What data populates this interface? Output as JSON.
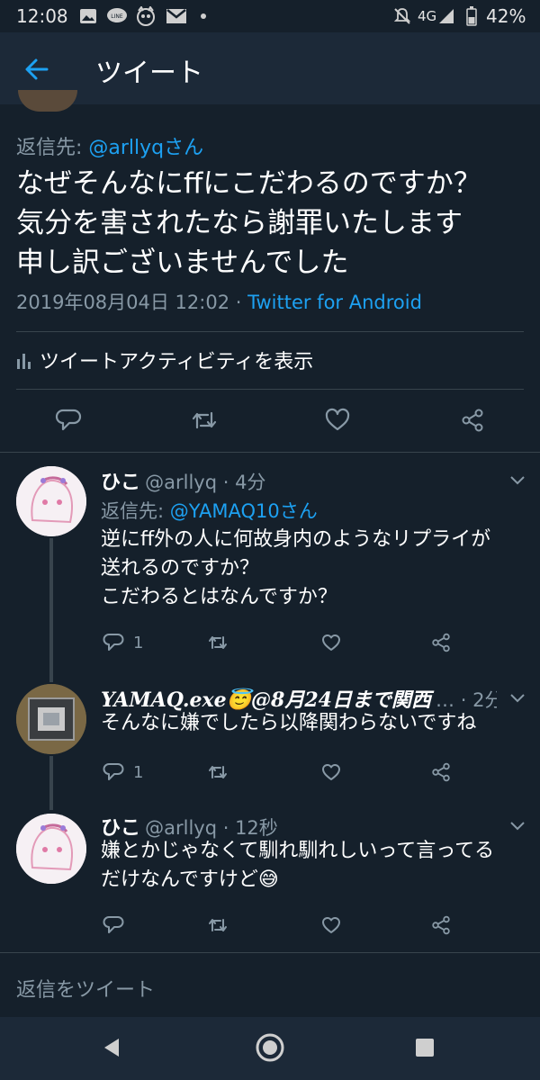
{
  "status_bar": {
    "time": "12:08",
    "network": "4G",
    "battery": "42%"
  },
  "header": {
    "title": "ツイート"
  },
  "main_tweet": {
    "reply_to_prefix": "返信先: ",
    "reply_to_user": "@arllyqさん",
    "text": "なぜそんなにffにこだわるのですか？\n気分を害されたなら謝罪いたします\n申し訳ございませんでした",
    "timestamp": "2019年08月04日 12:02",
    "separator": " · ",
    "source": "Twitter for Android",
    "activity_label": "ツイートアクティビティを表示"
  },
  "replies": [
    {
      "name": "ひこ",
      "handle": "@arllyq",
      "time": " · 4分",
      "reply_to_prefix": "返信先: ",
      "reply_to_user": "@YAMAQ10さん",
      "text": "逆にff外の人に何故身内のようなリプライが\n送れるのですか？\nこだわるとはなんですか？",
      "reply_count": "1"
    },
    {
      "name": "YAMAQ.exe😇@8月24日まで関西",
      "handle": "…",
      "time": " · 2分",
      "text": "そんなに嫌でしたら以降関わらないですね",
      "reply_count": "1"
    },
    {
      "name": "ひこ",
      "handle": "@arllyq",
      "time": " · 12秒",
      "text": "嫌とかじゃなくて馴れ馴れしいって言ってる\nだけなんですけど😅",
      "reply_count": ""
    }
  ],
  "compose": {
    "placeholder": "返信をツイート"
  },
  "colors": {
    "background": "#15202b",
    "header": "#1c2938",
    "accent": "#1da1f2",
    "muted": "#8899a6",
    "divider": "#38444d"
  }
}
